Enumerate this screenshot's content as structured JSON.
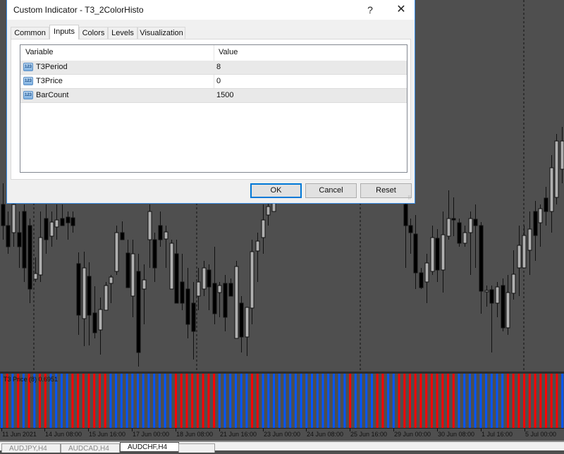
{
  "dialog": {
    "title": "Custom Indicator - T3_2ColorHisto",
    "help_label": "?",
    "close_label": "✕",
    "tabs": [
      {
        "label": "Common",
        "active": false
      },
      {
        "label": "Inputs",
        "active": true
      },
      {
        "label": "Colors",
        "active": false
      },
      {
        "label": "Levels",
        "active": false
      },
      {
        "label": "Visualization",
        "active": false
      }
    ],
    "grid": {
      "columns": [
        "Variable",
        "Value"
      ],
      "rows": [
        {
          "icon": "number-icon",
          "icon_text": "123",
          "variable": "T3Period",
          "value": "8"
        },
        {
          "icon": "number-icon",
          "icon_text": "123",
          "variable": "T3Price",
          "value": "0"
        },
        {
          "icon": "number-icon",
          "icon_text": "123",
          "variable": "BarCount",
          "value": "1500"
        }
      ]
    },
    "buttons": {
      "ok": "OK",
      "cancel": "Cancel",
      "reset": "Reset"
    }
  },
  "indicator": {
    "label": "T3 Price (8) 0.6951",
    "colors": {
      "up": "#0055ff",
      "down": "#ff0000"
    },
    "bar_colors": "BRBRBRBRRBBBBRRRRRRRBBBBBBBBBBBBRRRRRRRRBBBBBBRRBBBBBBBBBBBBBBBBRBBBBRRBBRRRRRRRRRRRBBBBBBBBBRRRRRRRRRRBBBBBBBBB"
  },
  "time_axis": {
    "labels": [
      "11 Jun 2021",
      "14 Jun 08:00",
      "15 Jun 16:00",
      "17 Jun 00:00",
      "18 Jun 08:00",
      "21 Jun 16:00",
      "23 Jun 00:00",
      "24 Jun 08:00",
      "25 Jun 16:00",
      "29 Jun 00:00",
      "30 Jun 08:00",
      "1 Jul 16:00",
      "5 Jul 00:00"
    ]
  },
  "chart_tabs": [
    {
      "label": "AUDJPY,H4",
      "active": false
    },
    {
      "label": "AUDCAD,H4",
      "active": false
    },
    {
      "label": "AUDCHF,H4",
      "active": true
    }
  ],
  "chart_colors": {
    "background": "#4f4f4f",
    "bull_body": "#b0b0b0",
    "bear_body": "#000000",
    "wick": "#111111"
  }
}
